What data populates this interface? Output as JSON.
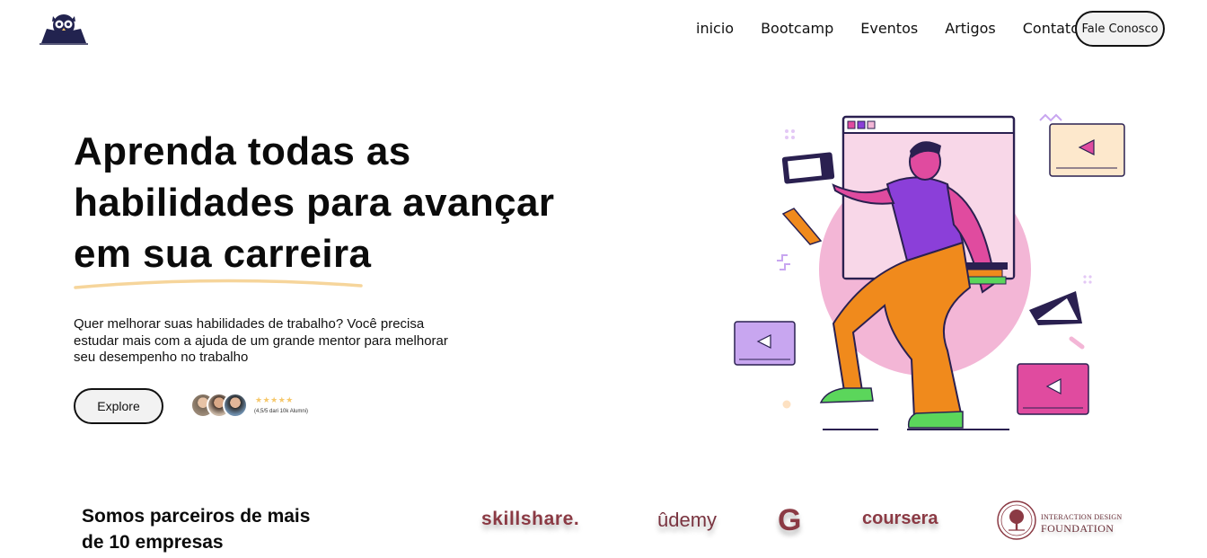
{
  "header": {
    "logo_icon": "owl-book-icon",
    "nav": [
      "inicio",
      "Bootcamp",
      "Eventos",
      "Artigos",
      "Contato"
    ],
    "cta_label": "Fale Conosco"
  },
  "hero": {
    "title": "Aprenda todas as habilidades para avançar em sua carreira",
    "subtitle": "Quer melhorar suas habilidades de trabalho? Você precisa estudar mais com a ajuda de um grande mentor para melhorar seu desempenho no trabalho",
    "explore_label": "Explore",
    "rating_stars": "★★★★★",
    "rating_text": "(4,5/5 dari 10k Alumni)",
    "rating_value": 4.5
  },
  "partners": {
    "title": "Somos parceiros de mais de 10 empresas",
    "logos": [
      "skillshare.",
      "ûdemy",
      "G",
      "coursera"
    ],
    "idf_line1": "INTERACTION DESIGN",
    "idf_line2": "FOUNDATION"
  },
  "colors": {
    "accent_purple": "#8b3fd9",
    "accent_pink": "#e04b9f",
    "accent_orange": "#f08a1c",
    "accent_green": "#5bd65b",
    "brand_maroon": "#8b3a44",
    "underline_yellow": "#f6d59b"
  }
}
